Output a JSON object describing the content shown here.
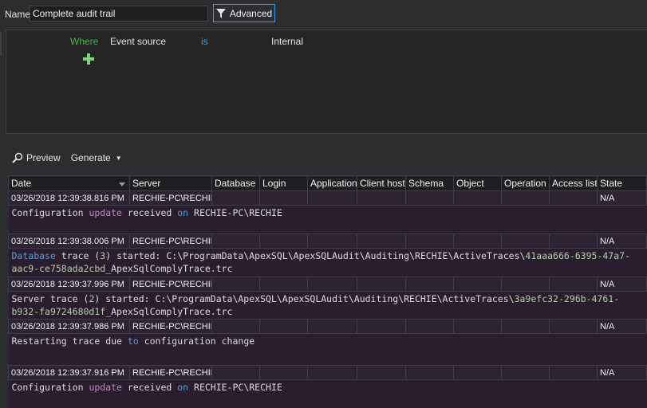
{
  "name_field": {
    "label": "Name",
    "value": "Complete audit trail"
  },
  "advanced_button": {
    "label": "Advanced"
  },
  "filter": {
    "where": "Where",
    "field": "Event source",
    "operator": "is",
    "value": "Internal"
  },
  "toolbar": {
    "preview": "Preview",
    "generate": "Generate"
  },
  "grid": {
    "columns": [
      "Date",
      "Server",
      "Database",
      "Login",
      "Application",
      "Client host",
      "Schema",
      "Object",
      "Operation",
      "Access list",
      "State"
    ],
    "rows": [
      {
        "date": "03/26/2018 12:39:38.816 PM",
        "server": "RECHIE-PC\\RECHIE",
        "state": "N/A",
        "detail": [
          {
            "t": "Configuration "
          },
          {
            "t": "update",
            "c": "purple"
          },
          {
            "t": " received "
          },
          {
            "t": "on",
            "c": "blue"
          },
          {
            "t": " RECHIE-PC\\RECHIE"
          }
        ]
      },
      {
        "date": "03/26/2018 12:39:38.006 PM",
        "server": "RECHIE-PC\\RECHIE",
        "state": "N/A",
        "detail": [
          {
            "t": "Database",
            "c": "blue"
          },
          {
            "t": " trace ("
          },
          {
            "t": "3",
            "c": "num"
          },
          {
            "t": ") started: C:\\ProgramData\\ApexSQL\\ApexSQLAudit\\Auditing\\RECHIE\\ActiveTraces\\"
          },
          {
            "t": "41aaa666-6395-47a7-aac9-ce758ada2cbd",
            "c": "num"
          },
          {
            "t": "_ApexSqlComplyTrace.trc"
          }
        ]
      },
      {
        "date": "03/26/2018 12:39:37.996 PM",
        "server": "RECHIE-PC\\RECHIE",
        "state": "N/A",
        "detail": [
          {
            "t": "Server trace ("
          },
          {
            "t": "2",
            "c": "num"
          },
          {
            "t": ") started: C:\\ProgramData\\ApexSQL\\ApexSQLAudit\\Auditing\\RECHIE\\ActiveTraces\\"
          },
          {
            "t": "3a9efc32-296b-4761-b932-fa9724680d1f",
            "c": "num"
          },
          {
            "t": "_ApexSqlComplyTrace.trc"
          }
        ]
      },
      {
        "date": "03/26/2018 12:39:37.986 PM",
        "server": "RECHIE-PC\\RECHIE",
        "state": "N/A",
        "detail": [
          {
            "t": "Restarting trace due "
          },
          {
            "t": "to",
            "c": "blue"
          },
          {
            "t": " configuration change"
          }
        ]
      },
      {
        "date": "03/26/2018 12:39:37.916 PM",
        "server": "RECHIE-PC\\RECHIE",
        "state": "N/A",
        "detail": [
          {
            "t": "Configuration "
          },
          {
            "t": "update",
            "c": "purple"
          },
          {
            "t": " received "
          },
          {
            "t": "on",
            "c": "blue"
          },
          {
            "t": " RECHIE-PC\\RECHIE"
          }
        ]
      }
    ]
  },
  "colors": {
    "background": "#2d2d30",
    "accent_border": "#3399ff",
    "where_green": "#4caf50",
    "operator_blue": "#3c9eff",
    "row_bg": "#2d2332",
    "keyword_purple": "#c586c0",
    "keyword_blue": "#569cd6"
  },
  "icons": {
    "advanced": "filter-icon",
    "preview": "magnifier-icon",
    "add": "plus-icon"
  }
}
